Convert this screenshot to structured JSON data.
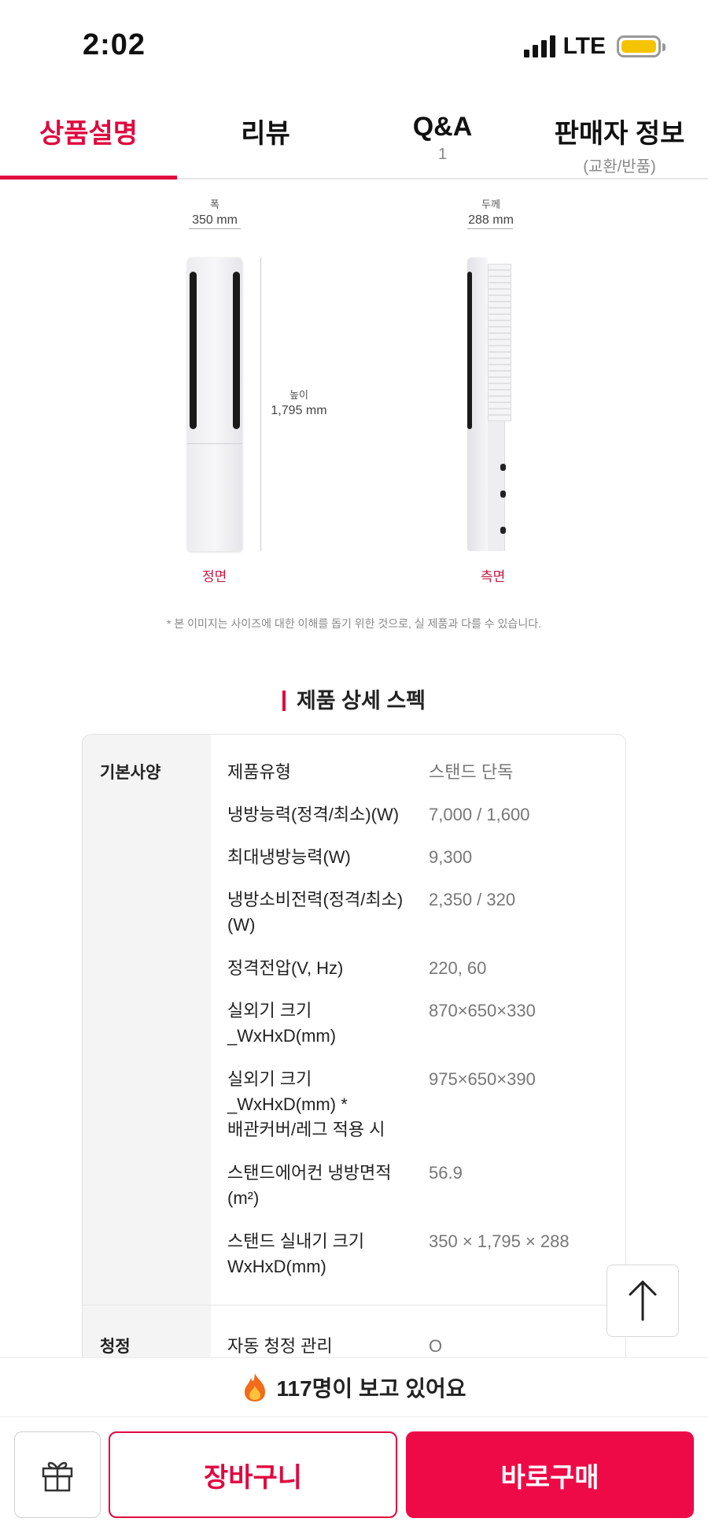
{
  "status_bar": {
    "time": "2:02",
    "network": "LTE",
    "battery_color": "#f5c400"
  },
  "tabs": [
    {
      "label": "상품설명",
      "sub": "",
      "active": true
    },
    {
      "label": "리뷰",
      "sub": ""
    },
    {
      "label": "Q&A",
      "sub": "1"
    },
    {
      "label": "판매자 정보",
      "sub": "(교환/반품)"
    }
  ],
  "diagram": {
    "width_label": "폭",
    "width_value": "350 mm",
    "height_label": "높이",
    "height_value": "1,795 mm",
    "depth_label": "두께",
    "depth_value": "288 mm",
    "front_label": "정면",
    "side_label": "측면",
    "note": "* 본 이미지는 사이즈에 대한 이해를 돕기 위한 것으로, 실 제품과 다를 수 있습니다."
  },
  "spec": {
    "title": "제품 상세 스펙",
    "category_basic": "기본사양",
    "category_clean": "청정",
    "rows": [
      {
        "key": "제품유형",
        "value": "스탠드 단독"
      },
      {
        "key": "냉방능력(정격/최소)(W)",
        "value": "7,000 / 1,600"
      },
      {
        "key": "최대냉방능력(W)",
        "value": "9,300"
      },
      {
        "key": "냉방소비전력(정격/최소)\n(W)",
        "value": "2,350 / 320"
      },
      {
        "key": "정격전압(V, Hz)",
        "value": "220, 60"
      },
      {
        "key": "실외기 크기\n_WxHxD(mm)",
        "value": "870×650×330"
      },
      {
        "key": "실외기 크기\n_WxHxD(mm) *\n배관커버/레그 적용 시",
        "value": "975×650×390"
      },
      {
        "key": "스탠드에어컨 냉방면적\n(m²)",
        "value": "56.9"
      },
      {
        "key": "스탠드 실내기 크기\nWxHxD(mm)",
        "value": "350 × 1,795 × 288"
      },
      {
        "key": "자동 청정 관리",
        "value": "O"
      }
    ]
  },
  "viewers": {
    "icon": "fire-icon",
    "text": "117명이 보고 있어요"
  },
  "actions": {
    "cart_label": "장바구니",
    "buy_label": "바로구매",
    "gift_icon": "gift-icon",
    "accent": "#e0083f"
  }
}
